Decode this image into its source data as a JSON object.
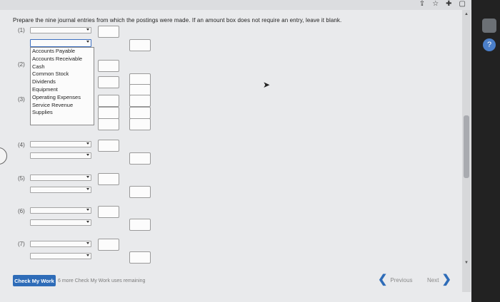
{
  "instruction": "Prepare the nine journal entries from which the postings were made. If an amount box does not require an entry, leave it blank.",
  "entries": [
    "(1)",
    "(2)",
    "(3)",
    "(4)",
    "(5)",
    "(6)",
    "(7)"
  ],
  "dropdown": {
    "options": [
      "Accounts Payable",
      "Accounts Receivable",
      "Cash",
      "Common Stock",
      "Dividends",
      "Equipment",
      "Operating Expenses",
      "Service Revenue",
      "Supplies"
    ]
  },
  "footer": {
    "check_label": "Check My Work",
    "remaining_text": "6 more Check My Work uses remaining",
    "previous_label": "Previous",
    "next_label": "Next"
  },
  "icons": {
    "bookmark": "star-icon",
    "accent": "#2e6cb8"
  }
}
